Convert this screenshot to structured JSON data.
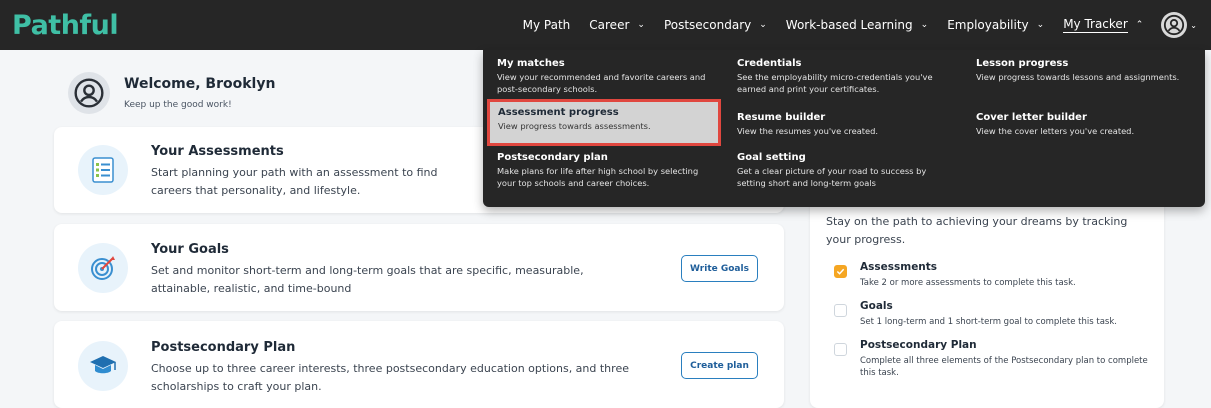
{
  "brand": {
    "name": "Pathful",
    "color": "#3fbfa5"
  },
  "nav": {
    "items": [
      {
        "label": "My Path",
        "dropdown": false
      },
      {
        "label": "Career",
        "dropdown": true
      },
      {
        "label": "Postsecondary",
        "dropdown": true
      },
      {
        "label": "Work-based Learning",
        "dropdown": true
      },
      {
        "label": "Employability",
        "dropdown": true
      },
      {
        "label": "My Tracker",
        "dropdown": true,
        "active": true
      }
    ],
    "avatar_icon": "user-circle-icon"
  },
  "welcome": {
    "title": "Welcome, Brooklyn",
    "subtitle": "Keep up the good work!"
  },
  "cards": [
    {
      "icon": "checklist-icon",
      "title": "Your Assessments",
      "desc": "Start planning your path with an assessment to find careers that personality, and lifestyle."
    },
    {
      "icon": "target-icon",
      "title": "Your Goals",
      "desc": "Set and monitor short-term and long-term goals that are specific, measurable, attainable, realistic, and time-bound",
      "button": "Write Goals"
    },
    {
      "icon": "graduation-cap-icon",
      "title": "Postsecondary Plan",
      "desc": "Choose up to three career interests, three postsecondary education options, and three scholarships to craft your plan.",
      "button": "Create plan"
    }
  ],
  "tracker": {
    "intro": "Stay on the path to achieving your dreams by tracking your progress.",
    "tasks": [
      {
        "title": "Assessments",
        "desc": "Take 2 or more assessments to complete this task.",
        "checked": true
      },
      {
        "title": "Goals",
        "desc": "Set 1 long-term and 1 short-term goal to complete this task.",
        "checked": false
      },
      {
        "title": "Postsecondary Plan",
        "desc": "Complete all three elements of the Postsecondary plan to complete this task.",
        "checked": false
      }
    ]
  },
  "dropdown": {
    "col1": [
      {
        "title": "My matches",
        "desc": "View your recommended and favorite careers and post-secondary schools."
      },
      {
        "title": "Assessment progress",
        "desc": "View progress towards assessments.",
        "highlighted": true
      },
      {
        "title": "Postsecondary plan",
        "desc": "Make plans for life after high school by selecting your top schools and career choices."
      }
    ],
    "col2": [
      {
        "title": "Credentials",
        "desc": "See the employability micro-credentials you've earned and print your certificates."
      },
      {
        "title": "Resume builder",
        "desc": "View the resumes you've created."
      },
      {
        "title": "Goal setting",
        "desc": "Get a clear picture of your road to success by setting short and long-term goals"
      }
    ],
    "col3": [
      {
        "title": "Lesson progress",
        "desc": "View progress towards lessons and assignments."
      },
      {
        "title": "Cover letter builder",
        "desc": "View the cover letters you've created."
      }
    ]
  }
}
